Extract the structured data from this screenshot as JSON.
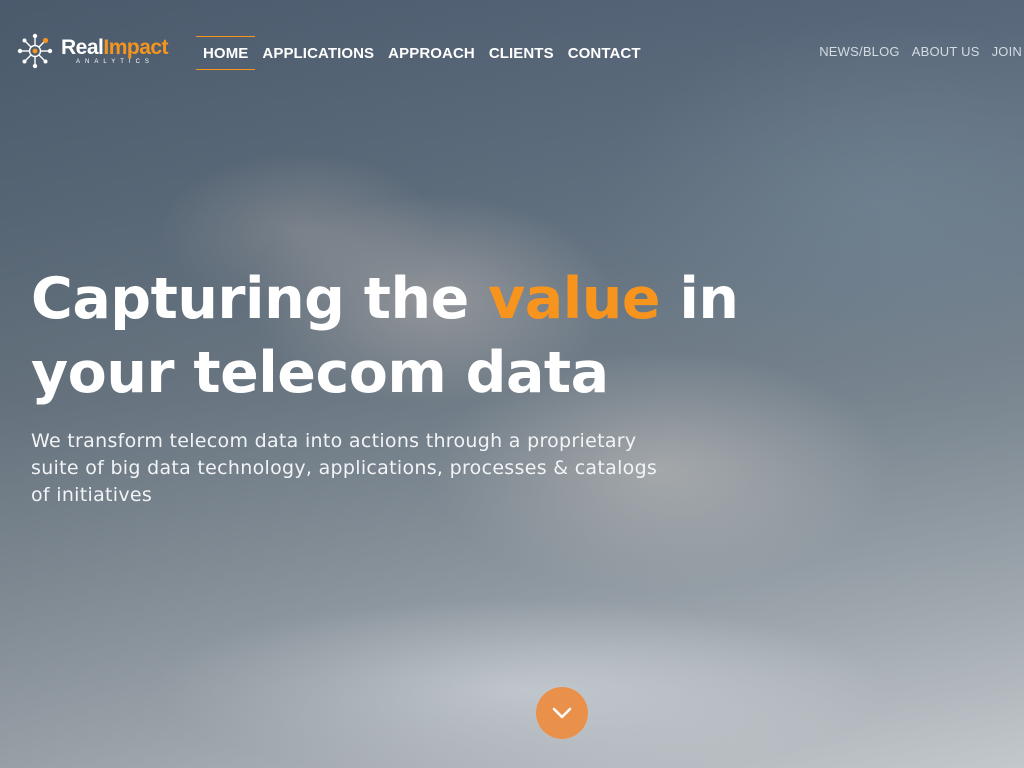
{
  "brand": {
    "name_part1": "Real",
    "name_part2": "Impact",
    "tagline": "ANALYTICS",
    "logo_icon": "network-nodes-icon",
    "accent_color": "#f7941d"
  },
  "nav": {
    "main": [
      {
        "label": "HOME",
        "active": true
      },
      {
        "label": "APPLICATIONS",
        "active": false
      },
      {
        "label": "APPROACH",
        "active": false
      },
      {
        "label": "CLIENTS",
        "active": false
      },
      {
        "label": "CONTACT",
        "active": false
      }
    ],
    "secondary": [
      {
        "label": "NEWS/BLOG"
      },
      {
        "label": "ABOUT US"
      },
      {
        "label": "JOIN"
      }
    ]
  },
  "hero": {
    "headline_before": "Capturing the ",
    "headline_highlight": "value",
    "headline_after": " in your telecom data",
    "subtext": "We transform telecom data into actions through a proprietary suite of big data technology, applications, processes & catalogs of initiatives",
    "scroll_icon": "chevron-down-icon"
  }
}
